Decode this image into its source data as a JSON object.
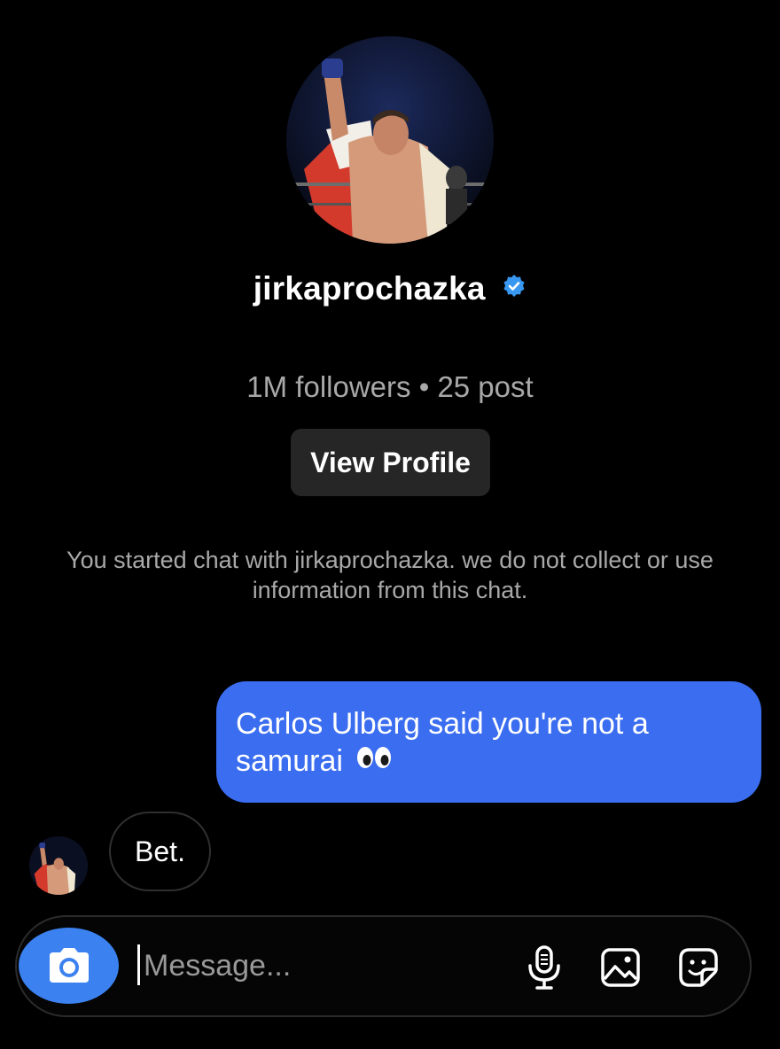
{
  "profile": {
    "username": "jirkaprochazka",
    "verified": true,
    "followers_text": "1M followers",
    "separator": "•",
    "posts_text": "25 post",
    "view_profile_label": "View Profile",
    "avatar_icon": "profile-photo"
  },
  "notice": {
    "text": "You started chat with jirkaprochazka. we do not collect or use information from this chat."
  },
  "messages": [
    {
      "sender": "me",
      "text": "Carlos Ulberg said you're not a samurai",
      "emoji": "eyes-emoji"
    },
    {
      "sender": "them",
      "text": "Bet."
    }
  ],
  "composer": {
    "placeholder": "Message...",
    "value": "",
    "icons": [
      "camera-icon",
      "microphone-icon",
      "gallery-icon",
      "sticker-icon"
    ]
  },
  "colors": {
    "background": "#000000",
    "outgoing_bubble": "#3a6df0",
    "camera_button": "#3b82f0",
    "view_profile_button": "#262626",
    "secondary_text": "#a8a8a8",
    "verified_badge": "#3897f0"
  }
}
